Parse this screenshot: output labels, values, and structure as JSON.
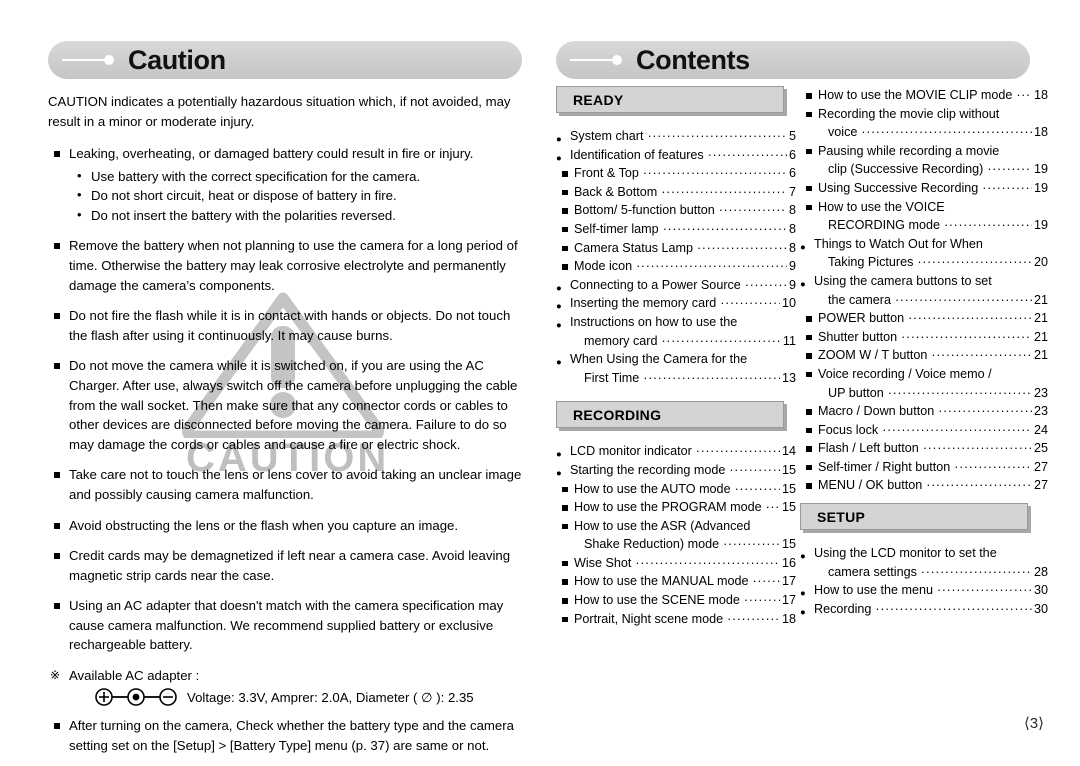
{
  "left": {
    "header_title": "Caution",
    "intro": "CAUTION indicates a potentially hazardous situation which, if not avoided, may result in a minor or moderate injury.",
    "items": [
      {
        "text": "Leaking, overheating, or damaged battery could result in fire or injury.",
        "subitems": [
          "Use battery with the correct specification for the camera.",
          "Do not short circuit, heat or dispose of battery in fire.",
          "Do not insert the battery with the polarities reversed."
        ]
      },
      {
        "text": "Remove the battery when not planning to use the camera for a long period of time. Otherwise the battery may leak corrosive electrolyte and permanently damage the camera’s components.",
        "subitems": []
      },
      {
        "text": "Do not fire the flash while it is in contact with hands or objects. Do not touch the flash after using it continuously. It may cause burns.",
        "subitems": []
      },
      {
        "text": "Do not move the camera while it is switched on, if you are using the AC Charger. After use, always switch off the camera before unplugging the cable from the wall socket. Then make sure that any connector cords or cables to other devices are disconnected before moving the camera. Failure to do so may damage the cords or cables and cause a fire or electric shock.",
        "subitems": []
      },
      {
        "text": "Take care not to touch the lens or lens cover to avoid taking an unclear image and possibly causing camera malfunction.",
        "subitems": []
      },
      {
        "text": "Avoid obstructing the lens or the flash when you capture an image.",
        "subitems": []
      },
      {
        "text": "Credit cards may be demagnetized if left near a camera case. Avoid leaving magnetic strip cards near the case.",
        "subitems": []
      },
      {
        "text": "Using an AC adapter that doesn't match with the camera specification may cause camera malfunction. We recommend supplied battery or exclusive rechargeable battery.",
        "subitems": []
      }
    ],
    "note_mark": "※",
    "note_text": "Available AC adapter :",
    "adapter_spec": "Voltage: 3.3V, Amprer: 2.0A, Diameter ( ∅ ): 2.35",
    "final_item": "After turning on the camera, Check whether the battery type and the camera setting set on the [Setup] > [Battery Type] menu (p. 37) are same or not.",
    "watermark_text": "CAUTION"
  },
  "contents": {
    "header_title": "Contents",
    "sections": [
      {
        "id": "ready",
        "label": "READY"
      },
      {
        "id": "recording",
        "label": "RECORDING"
      },
      {
        "id": "setup",
        "label": "SETUP"
      }
    ],
    "column1": [
      {
        "level": 1,
        "text": "System chart",
        "page": "5"
      },
      {
        "level": 1,
        "text": "Identification of features",
        "page": "6"
      },
      {
        "level": 2,
        "text": "Front & Top",
        "page": "6"
      },
      {
        "level": 2,
        "text": "Back & Bottom",
        "page": "7"
      },
      {
        "level": 2,
        "text": "Bottom/ 5-function button",
        "page": "8"
      },
      {
        "level": 2,
        "text": "Self-timer lamp",
        "page": "8"
      },
      {
        "level": 2,
        "text": "Camera Status Lamp",
        "page": "8"
      },
      {
        "level": 2,
        "text": "Mode icon",
        "page": "9"
      },
      {
        "level": 1,
        "text": "Connecting to a Power Source",
        "page": "9"
      },
      {
        "level": 1,
        "text": "Inserting the memory card",
        "page": "10"
      },
      {
        "level": 1,
        "text": "Instructions on how to use the",
        "page": ""
      },
      {
        "level": 0,
        "text": "memory card",
        "page": "11"
      },
      {
        "level": 1,
        "text": "When Using the Camera for the",
        "page": ""
      },
      {
        "level": 0,
        "text": "First Time",
        "page": "13"
      }
    ],
    "column1b": [
      {
        "level": 1,
        "text": "LCD monitor indicator",
        "page": "14"
      },
      {
        "level": 1,
        "text": "Starting the recording mode",
        "page": "15"
      },
      {
        "level": 2,
        "text": "How to use the AUTO mode",
        "page": "15"
      },
      {
        "level": 2,
        "text": "How to use the PROGRAM mode",
        "page": "15"
      },
      {
        "level": 2,
        "text": "How to use the ASR (Advanced",
        "page": ""
      },
      {
        "level": 0,
        "text": "Shake Reduction) mode",
        "page": "15"
      },
      {
        "level": 2,
        "text": "Wise Shot",
        "page": "16"
      },
      {
        "level": 2,
        "text": "How to use the MANUAL mode",
        "page": "17"
      },
      {
        "level": 2,
        "text": "How to use the SCENE mode",
        "page": "17"
      },
      {
        "level": 2,
        "text": "Portrait, Night scene mode",
        "page": "18"
      }
    ],
    "column2": [
      {
        "level": 2,
        "text": "How to use the MOVIE CLIP mode",
        "page": "18"
      },
      {
        "level": 2,
        "text": "Recording the movie clip without",
        "page": ""
      },
      {
        "level": 0,
        "text": "voice",
        "page": "18"
      },
      {
        "level": 2,
        "text": "Pausing while recording a movie",
        "page": ""
      },
      {
        "level": 0,
        "text": "clip (Successive Recording)",
        "page": "19"
      },
      {
        "level": 2,
        "text": "Using Successive Recording",
        "page": "19"
      },
      {
        "level": 2,
        "text": "How to use the VOICE",
        "page": ""
      },
      {
        "level": 0,
        "text": "RECORDING mode",
        "page": "19"
      },
      {
        "level": 1,
        "text": "Things to Watch Out for When",
        "page": ""
      },
      {
        "level": 0,
        "text": "Taking Pictures",
        "page": "20"
      },
      {
        "level": 1,
        "text": "Using the camera buttons to set",
        "page": ""
      },
      {
        "level": 0,
        "text": "the camera",
        "page": "21"
      },
      {
        "level": 2,
        "text": "POWER button",
        "page": "21"
      },
      {
        "level": 2,
        "text": "Shutter button",
        "page": "21"
      },
      {
        "level": 2,
        "text": "ZOOM W / T button",
        "page": "21"
      },
      {
        "level": 2,
        "text": "Voice recording / Voice memo /",
        "page": ""
      },
      {
        "level": 0,
        "text": "UP button",
        "page": "23"
      },
      {
        "level": 2,
        "text": "Macro / Down button",
        "page": "23"
      },
      {
        "level": 2,
        "text": "Focus lock",
        "page": "24"
      },
      {
        "level": 2,
        "text": "Flash / Left button",
        "page": "25"
      },
      {
        "level": 2,
        "text": "Self-timer / Right button",
        "page": "27"
      },
      {
        "level": 2,
        "text": "MENU / OK button",
        "page": "27"
      }
    ],
    "column2b": [
      {
        "level": 1,
        "text": "Using the LCD monitor to set the",
        "page": ""
      },
      {
        "level": 0,
        "text": "camera settings",
        "page": "28"
      },
      {
        "level": 1,
        "text": "How to use the menu",
        "page": "30"
      },
      {
        "level": 1,
        "text": "Recording",
        "page": "30"
      }
    ]
  },
  "page_number": "あ3ぃ",
  "page_number_display": "⟨3⟩",
  "colors": {
    "pill_bg": "#d2d2d2",
    "section_box_bg": "#d4d4d4",
    "section_box_shadow": "#a8a8a8",
    "watermark": "#bfbfbf",
    "text": "#000000"
  }
}
